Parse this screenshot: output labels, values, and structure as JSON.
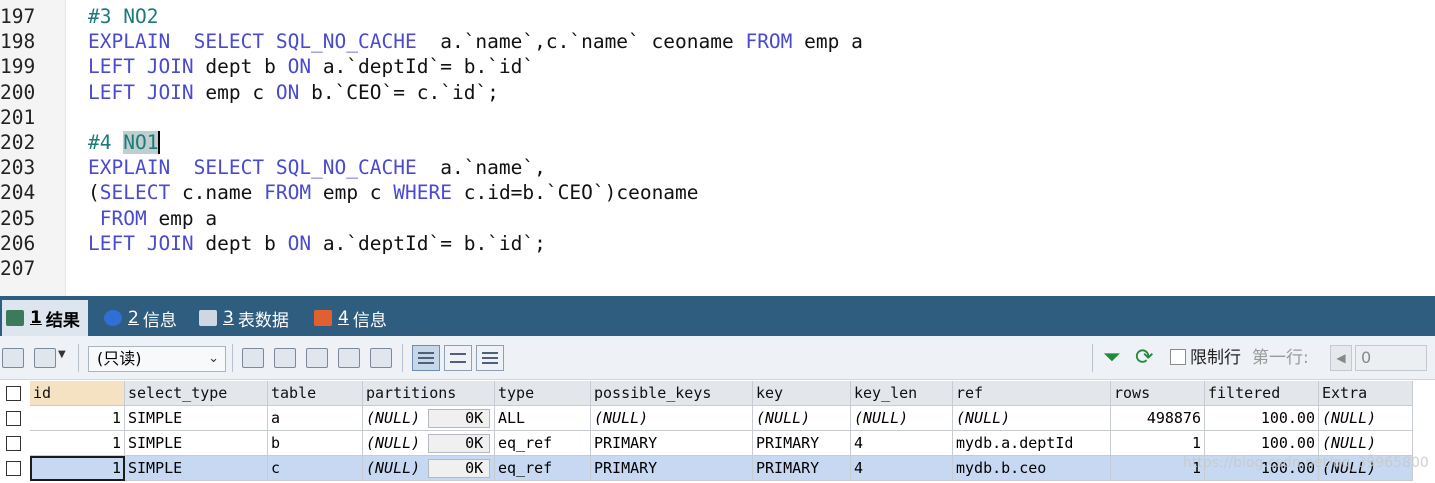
{
  "editor": {
    "lines": [
      {
        "num": "197",
        "segments": [
          {
            "t": "#3 NO2",
            "c": "cm"
          }
        ]
      },
      {
        "num": "198",
        "segments": [
          {
            "t": "EXPLAIN  SELECT SQL_NO_CACHE ",
            "c": "kw"
          },
          {
            "t": " a.`name`,c.`name` ceoname ",
            "c": ""
          },
          {
            "t": "FROM",
            "c": "kw"
          },
          {
            "t": " emp a",
            "c": ""
          }
        ]
      },
      {
        "num": "199",
        "segments": [
          {
            "t": "LEFT JOIN",
            "c": "kw"
          },
          {
            "t": " dept b ",
            "c": ""
          },
          {
            "t": "ON",
            "c": "kw"
          },
          {
            "t": " a.`deptId`= b.`id`",
            "c": ""
          }
        ]
      },
      {
        "num": "200",
        "segments": [
          {
            "t": "LEFT JOIN",
            "c": "kw"
          },
          {
            "t": " emp c ",
            "c": ""
          },
          {
            "t": "ON",
            "c": "kw"
          },
          {
            "t": " b.`CEO`= c.`id`;",
            "c": ""
          }
        ]
      },
      {
        "num": "201",
        "segments": []
      },
      {
        "num": "202",
        "segments": [
          {
            "t": "#4 ",
            "c": "cm"
          },
          {
            "t": "NO1",
            "c": "cm hl caret"
          }
        ]
      },
      {
        "num": "203",
        "segments": [
          {
            "t": "EXPLAIN  SELECT SQL_NO_CACHE ",
            "c": "kw"
          },
          {
            "t": " a.`name`,",
            "c": ""
          }
        ]
      },
      {
        "num": "204",
        "segments": [
          {
            "t": "(",
            "c": ""
          },
          {
            "t": "SELECT",
            "c": "kw"
          },
          {
            "t": " c.name ",
            "c": ""
          },
          {
            "t": "FROM",
            "c": "kw"
          },
          {
            "t": " emp c ",
            "c": ""
          },
          {
            "t": "WHERE",
            "c": "kw"
          },
          {
            "t": " c.id=b.`CEO`)ceoname",
            "c": ""
          }
        ]
      },
      {
        "num": "205",
        "segments": [
          {
            "t": " FROM",
            "c": "kw"
          },
          {
            "t": " emp a",
            "c": ""
          }
        ]
      },
      {
        "num": "206",
        "segments": [
          {
            "t": "LEFT JOIN",
            "c": "kw"
          },
          {
            "t": " dept b ",
            "c": ""
          },
          {
            "t": "ON",
            "c": "kw"
          },
          {
            "t": " a.`deptId`= b.`id`;",
            "c": ""
          }
        ]
      },
      {
        "num": "207",
        "segments": []
      }
    ]
  },
  "tabs": [
    {
      "num": "1",
      "label": "结果",
      "icon": "result-grid-icon",
      "active": true
    },
    {
      "num": "2",
      "label": "信息",
      "icon": "info-icon",
      "active": false
    },
    {
      "num": "3",
      "label": "表数据",
      "icon": "table-data-icon",
      "active": false
    },
    {
      "num": "4",
      "label": "信息",
      "icon": "info-multi-icon",
      "active": false
    }
  ],
  "toolbar": {
    "mode_select": "(只读)",
    "limit_label": "限制行",
    "first_row_label": "第一行:",
    "first_row_value": "0"
  },
  "grid": {
    "columns": [
      "id",
      "select_type",
      "table",
      "partitions",
      "type",
      "possible_keys",
      "key",
      "key_len",
      "ref",
      "rows",
      "filtered",
      "Extra"
    ],
    "rows": [
      [
        "1",
        "SIMPLE",
        "a",
        "(NULL)",
        "ALL",
        "(NULL)",
        "(NULL)",
        "(NULL)",
        "(NULL)",
        "498876",
        "100.00",
        "(NULL)"
      ],
      [
        "1",
        "SIMPLE",
        "b",
        "(NULL)",
        "eq_ref",
        "PRIMARY",
        "PRIMARY",
        "4",
        "mydb.a.deptId",
        "1",
        "100.00",
        "(NULL)"
      ],
      [
        "1",
        "SIMPLE",
        "c",
        "(NULL)",
        "eq_ref",
        "PRIMARY",
        "PRIMARY",
        "4",
        "mydb.b.ceo",
        "1",
        "100.00",
        "(NULL)"
      ]
    ],
    "blob_size": "0K",
    "selected_row": 2
  },
  "watermark": "https://blog.csdn.net/qq_39965800"
}
